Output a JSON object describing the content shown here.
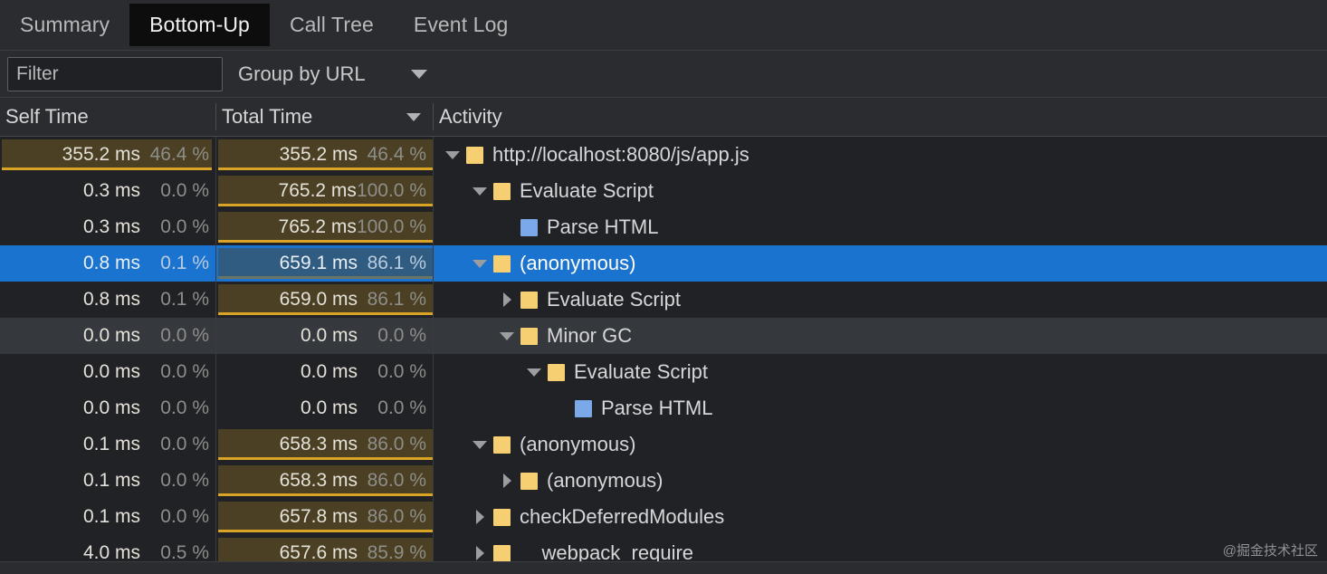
{
  "tabs": [
    {
      "label": "Summary",
      "active": false
    },
    {
      "label": "Bottom-Up",
      "active": true
    },
    {
      "label": "Call Tree",
      "active": false
    },
    {
      "label": "Event Log",
      "active": false
    }
  ],
  "toolbar": {
    "filter_placeholder": "Filter",
    "filter_value": "",
    "group_by_label": "Group by URL",
    "dropdown_icon": "chevron-down-icon"
  },
  "columns": {
    "self_time": "Self Time",
    "total_time": "Total Time",
    "activity": "Activity",
    "sorted_by": "total_time",
    "sort_icon": "caret-down-icon"
  },
  "colors": {
    "bar_fill": "#4b4024",
    "bar_border": "#d9a425",
    "selection": "#1a73cf",
    "scripting_swatch": "#f5cf72",
    "parsing_swatch": "#7ba8e8",
    "row_bg": "#212226",
    "hover_bg": "#35383c",
    "panel_bg": "#202124",
    "toolbar_bg": "#2b2c2f"
  },
  "rows": [
    {
      "self_ms": "355.2 ms",
      "self_pct": "46.4 %",
      "self_bar": 97,
      "total_ms": "355.2 ms",
      "total_pct": "46.4 %",
      "total_bar": 99,
      "activity": "http://localhost:8080/js/app.js",
      "depth": 0,
      "twisty": "expanded",
      "swatch": "scripting",
      "state": "normal"
    },
    {
      "self_ms": "0.3 ms",
      "self_pct": "0.0 %",
      "self_bar": 0,
      "total_ms": "765.2 ms",
      "total_pct": "100.0 %",
      "total_bar": 99,
      "activity": "Evaluate Script",
      "depth": 1,
      "twisty": "expanded",
      "swatch": "scripting",
      "state": "normal"
    },
    {
      "self_ms": "0.3 ms",
      "self_pct": "0.0 %",
      "self_bar": 0,
      "total_ms": "765.2 ms",
      "total_pct": "100.0 %",
      "total_bar": 99,
      "activity": "Parse HTML",
      "depth": 2,
      "twisty": "none",
      "swatch": "parsing",
      "state": "normal"
    },
    {
      "self_ms": "0.8 ms",
      "self_pct": "0.1 %",
      "self_bar": 0,
      "total_ms": "659.1 ms",
      "total_pct": "86.1 %",
      "total_bar": 99,
      "activity": "(anonymous)",
      "depth": 1,
      "twisty": "expanded",
      "swatch": "scripting",
      "state": "selected"
    },
    {
      "self_ms": "0.8 ms",
      "self_pct": "0.1 %",
      "self_bar": 0,
      "total_ms": "659.0 ms",
      "total_pct": "86.1 %",
      "total_bar": 99,
      "activity": "Evaluate Script",
      "depth": 2,
      "twisty": "collapsed",
      "swatch": "scripting",
      "state": "normal"
    },
    {
      "self_ms": "0.0 ms",
      "self_pct": "0.0 %",
      "self_bar": 0,
      "total_ms": "0.0 ms",
      "total_pct": "0.0 %",
      "total_bar": 0,
      "activity": "Minor GC",
      "depth": 2,
      "twisty": "expanded",
      "swatch": "scripting",
      "state": "hover"
    },
    {
      "self_ms": "0.0 ms",
      "self_pct": "0.0 %",
      "self_bar": 0,
      "total_ms": "0.0 ms",
      "total_pct": "0.0 %",
      "total_bar": 0,
      "activity": "Evaluate Script",
      "depth": 3,
      "twisty": "expanded",
      "swatch": "scripting",
      "state": "normal"
    },
    {
      "self_ms": "0.0 ms",
      "self_pct": "0.0 %",
      "self_bar": 0,
      "total_ms": "0.0 ms",
      "total_pct": "0.0 %",
      "total_bar": 0,
      "activity": "Parse HTML",
      "depth": 4,
      "twisty": "none",
      "swatch": "parsing",
      "state": "normal"
    },
    {
      "self_ms": "0.1 ms",
      "self_pct": "0.0 %",
      "self_bar": 0,
      "total_ms": "658.3 ms",
      "total_pct": "86.0 %",
      "total_bar": 99,
      "activity": "(anonymous)",
      "depth": 1,
      "twisty": "expanded",
      "swatch": "scripting",
      "state": "normal"
    },
    {
      "self_ms": "0.1 ms",
      "self_pct": "0.0 %",
      "self_bar": 0,
      "total_ms": "658.3 ms",
      "total_pct": "86.0 %",
      "total_bar": 99,
      "activity": "(anonymous)",
      "depth": 2,
      "twisty": "collapsed",
      "swatch": "scripting",
      "state": "normal"
    },
    {
      "self_ms": "0.1 ms",
      "self_pct": "0.0 %",
      "self_bar": 0,
      "total_ms": "657.8 ms",
      "total_pct": "86.0 %",
      "total_bar": 99,
      "activity": "checkDeferredModules",
      "depth": 1,
      "twisty": "collapsed",
      "swatch": "scripting",
      "state": "normal"
    },
    {
      "self_ms": "4.0 ms",
      "self_pct": "0.5 %",
      "self_bar": 0,
      "total_ms": "657.6 ms",
      "total_pct": "85.9 %",
      "total_bar": 99,
      "activity": "__webpack_require__",
      "depth": 1,
      "twisty": "collapsed",
      "swatch": "scripting",
      "state": "normal"
    }
  ],
  "watermark": "@掘金技术社区"
}
